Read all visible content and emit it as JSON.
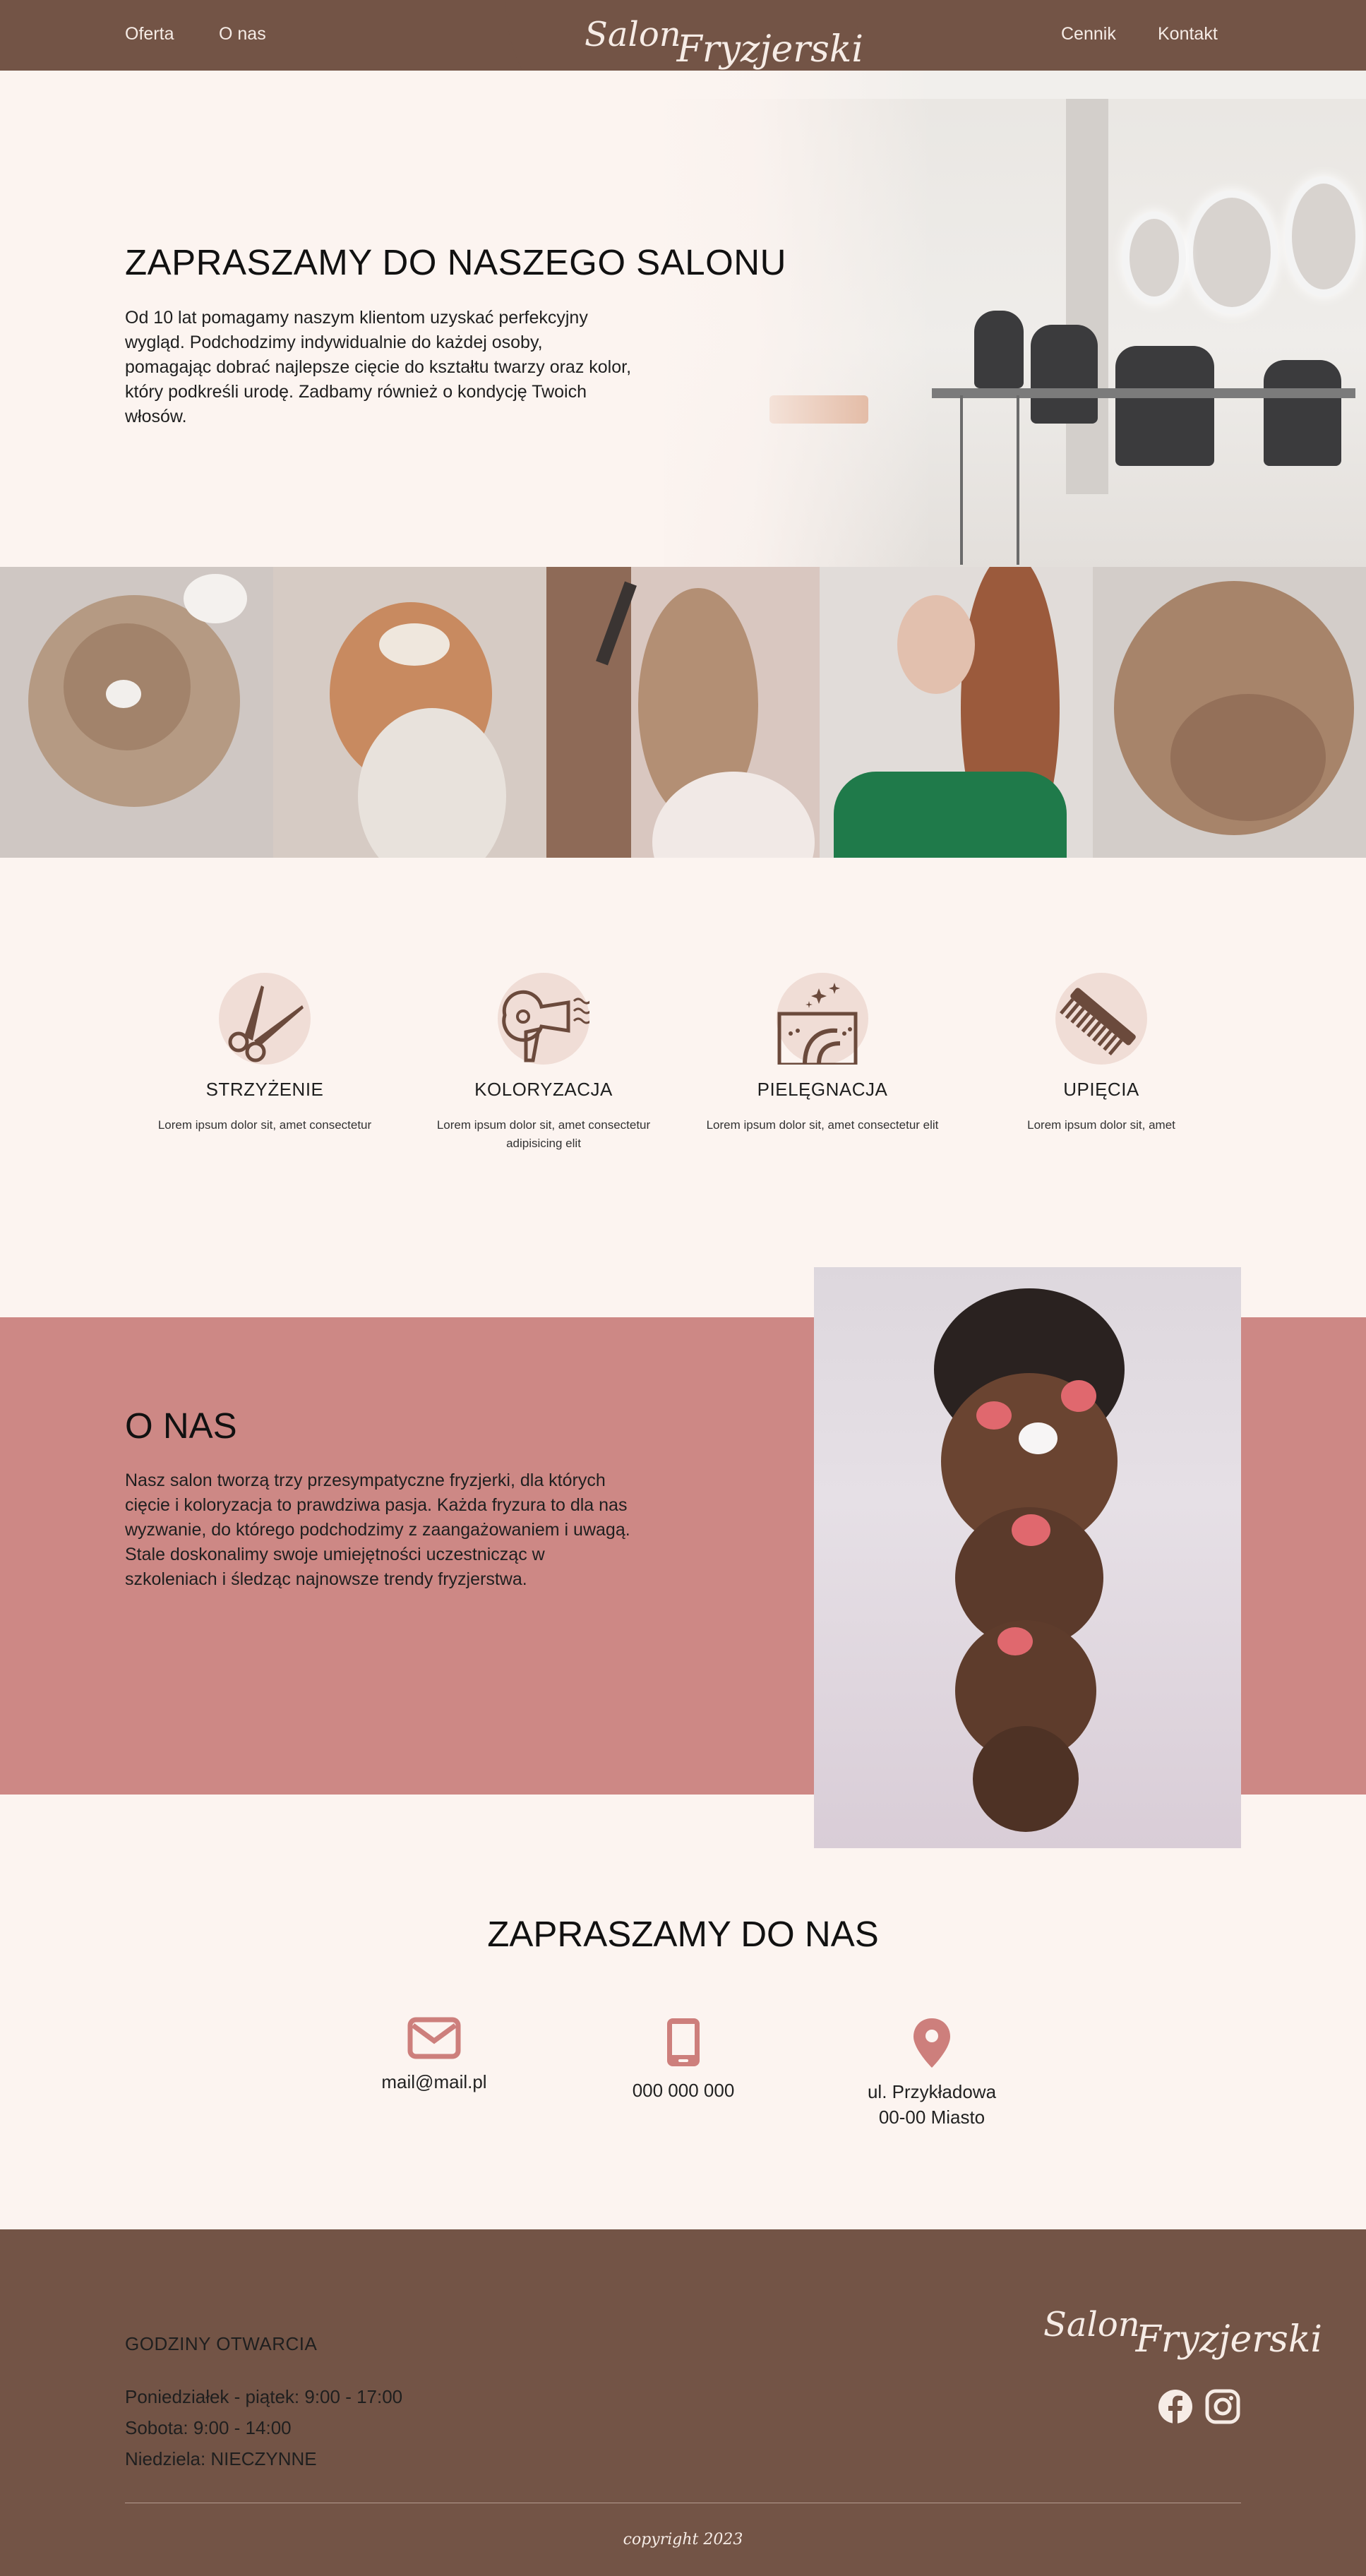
{
  "nav": {
    "left_links": [
      "Oferta",
      "O nas"
    ],
    "right_links": [
      "Cennik",
      "Kontakt"
    ],
    "logo_word1": "Salon",
    "logo_word2": "Fryzjerski"
  },
  "hero": {
    "title": "ZAPRASZAMY DO NASZEGO SALONU",
    "text": "Od 10 lat pomagamy naszym klientom uzyskać perfekcyjny wygląd. Podchodzimy indywidualnie do każdej osoby, pomagając dobrać najlepsze cięcie do kształtu twarzy oraz kolor, który podkreśli urodę. Zadbamy również o kondycję Twoich włosów."
  },
  "services": [
    {
      "icon": "scissors-icon",
      "title": "STRZYŻENIE",
      "desc": "Lorem ipsum dolor sit, amet consectetur"
    },
    {
      "icon": "hair-dryer-icon",
      "title": "KOLORYZACJA",
      "desc": "Lorem ipsum dolor sit, amet consectetur adipisicing elit"
    },
    {
      "icon": "hair-care-icon",
      "title": "PIELĘGNACJA",
      "desc": "Lorem ipsum dolor sit, amet consectetur elit"
    },
    {
      "icon": "comb-icon",
      "title": "UPIĘCIA",
      "desc": "Lorem ipsum dolor sit, amet"
    }
  ],
  "about": {
    "title": "O NAS",
    "text": "Nasz salon tworzą trzy przesympatyczne fryzjerki, dla których cięcie i koloryzacja to prawdziwa pasja. Każda fryzura to dla nas wyzwanie, do którego podchodzimy z zaangażowaniem i uwagą. Stale doskonalimy swoje umiejętności uczestnicząc w szkoleniach i śledząc najnowsze trendy fryzjerstwa."
  },
  "contact": {
    "title": "ZAPRASZAMY DO NAS",
    "email": "mail@mail.pl",
    "phone": "000 000 000",
    "address_line1": "ul. Przykładowa",
    "address_line2": "00-00 Miasto"
  },
  "footer": {
    "hours_title": "GODZINY OTWARCIA",
    "hours": [
      "Poniedziałek - piątek: 9:00 - 17:00",
      "Sobota: 9:00 - 14:00",
      "Niedziela: NIECZYNNE"
    ],
    "logo_word1": "Salon",
    "logo_word2": "Fryzjerski",
    "copyright": "copyright 2023"
  },
  "colors": {
    "brown": "#735446",
    "cream": "#fcf4f0",
    "rose": "#cd8885",
    "icon_bg": "#f0ddd6"
  }
}
